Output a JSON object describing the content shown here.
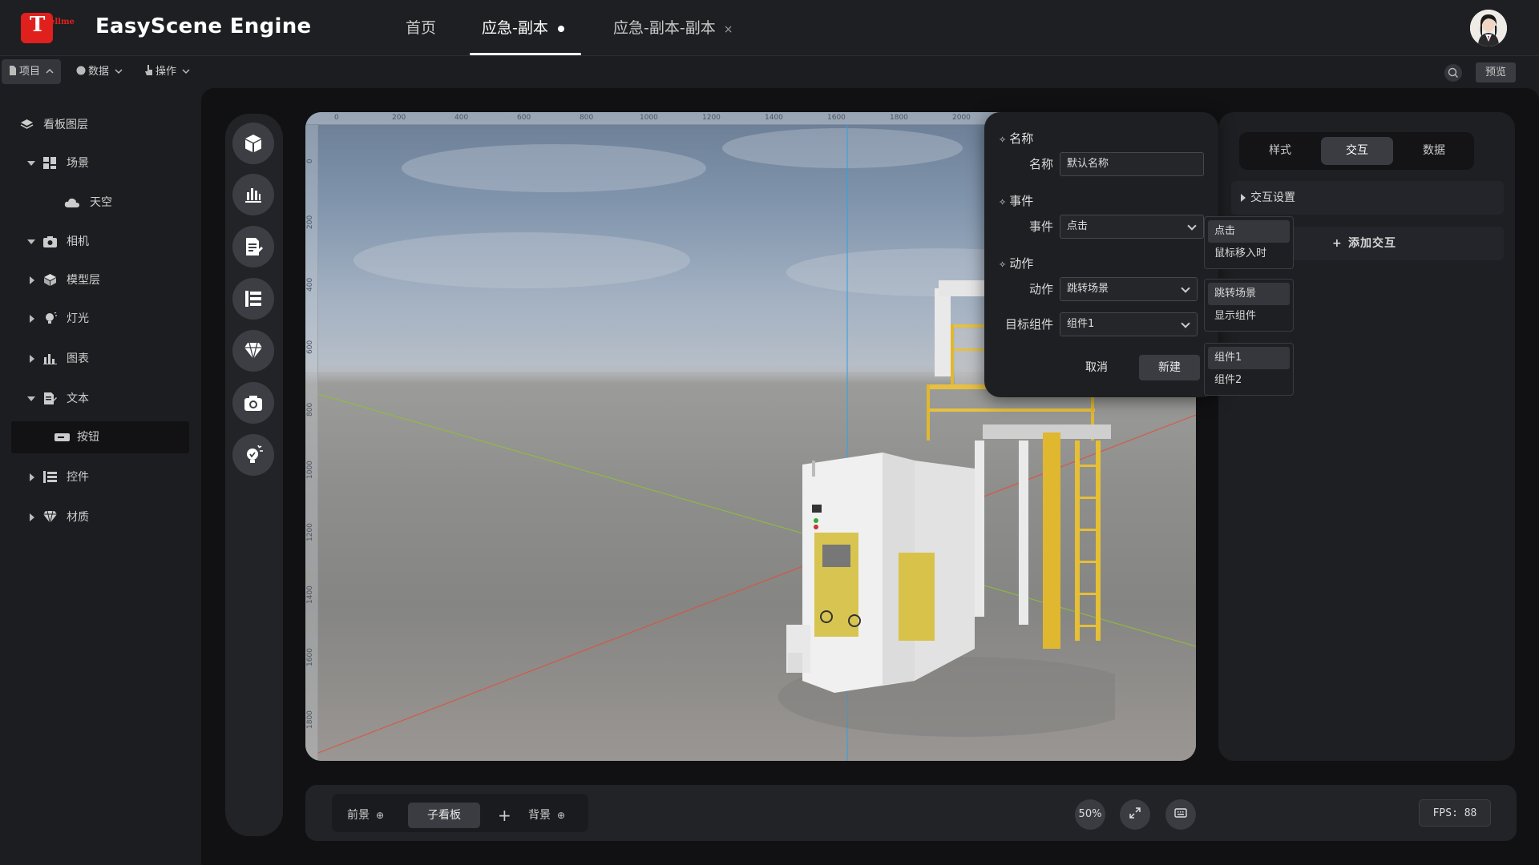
{
  "header": {
    "app_title": "EasyScene Engine",
    "logo_letter": "T",
    "logo_text": "ellme",
    "tabs": [
      {
        "label": "首页"
      },
      {
        "label": "应急-副本"
      },
      {
        "label": "应急-副本-副本",
        "close": "×"
      }
    ]
  },
  "toolbar": {
    "menus": [
      "项目",
      "数据",
      "操作"
    ],
    "preview_label": "预览"
  },
  "layers": {
    "title": "看板图层",
    "items": [
      {
        "label": "场景"
      },
      {
        "label": "天空"
      },
      {
        "label": "相机"
      },
      {
        "label": "模型层"
      },
      {
        "label": "灯光"
      },
      {
        "label": "图表"
      },
      {
        "label": "文本"
      },
      {
        "label": "按钮"
      },
      {
        "label": "控件"
      },
      {
        "label": "材质"
      }
    ]
  },
  "ruler": {
    "h": [
      "0",
      "200",
      "400",
      "600",
      "800",
      "1000",
      "1200",
      "1400",
      "1600",
      "1800",
      "2000"
    ],
    "v": [
      "0",
      "200",
      "400",
      "600",
      "800",
      "1000",
      "1200",
      "1400",
      "1600",
      "1800"
    ]
  },
  "dialog": {
    "section_name": "名称",
    "name_label": "名称",
    "name_value": "默认名称",
    "section_event": "事件",
    "event_label": "事件",
    "event_value": "点击",
    "section_action": "动作",
    "action_label": "动作",
    "action_value": "跳转场景",
    "target_label": "目标组件",
    "target_value": "组件1",
    "cancel_label": "取消",
    "create_label": "新建"
  },
  "popups": {
    "event_options": [
      "点击",
      "鼠标移入时"
    ],
    "action_options": [
      "跳转场景",
      "显示组件"
    ],
    "target_options": [
      "组件1",
      "组件2"
    ]
  },
  "right_panel": {
    "tabs": [
      "样式",
      "交互",
      "数据"
    ],
    "interaction_settings": "交互设置",
    "add_interaction": "添加交互"
  },
  "bottom": {
    "foreground": "前景",
    "sub_board": "子看板",
    "plus": "+",
    "background": "背景",
    "zoom": "50%",
    "fps": "FPS: 88"
  },
  "colors": {
    "brand_red": "#e0201d",
    "panel_bg": "#1e1f22",
    "axis_red": "#e0503a",
    "axis_green": "#8fbf3a",
    "axis_blue": "#3aa0e0"
  }
}
